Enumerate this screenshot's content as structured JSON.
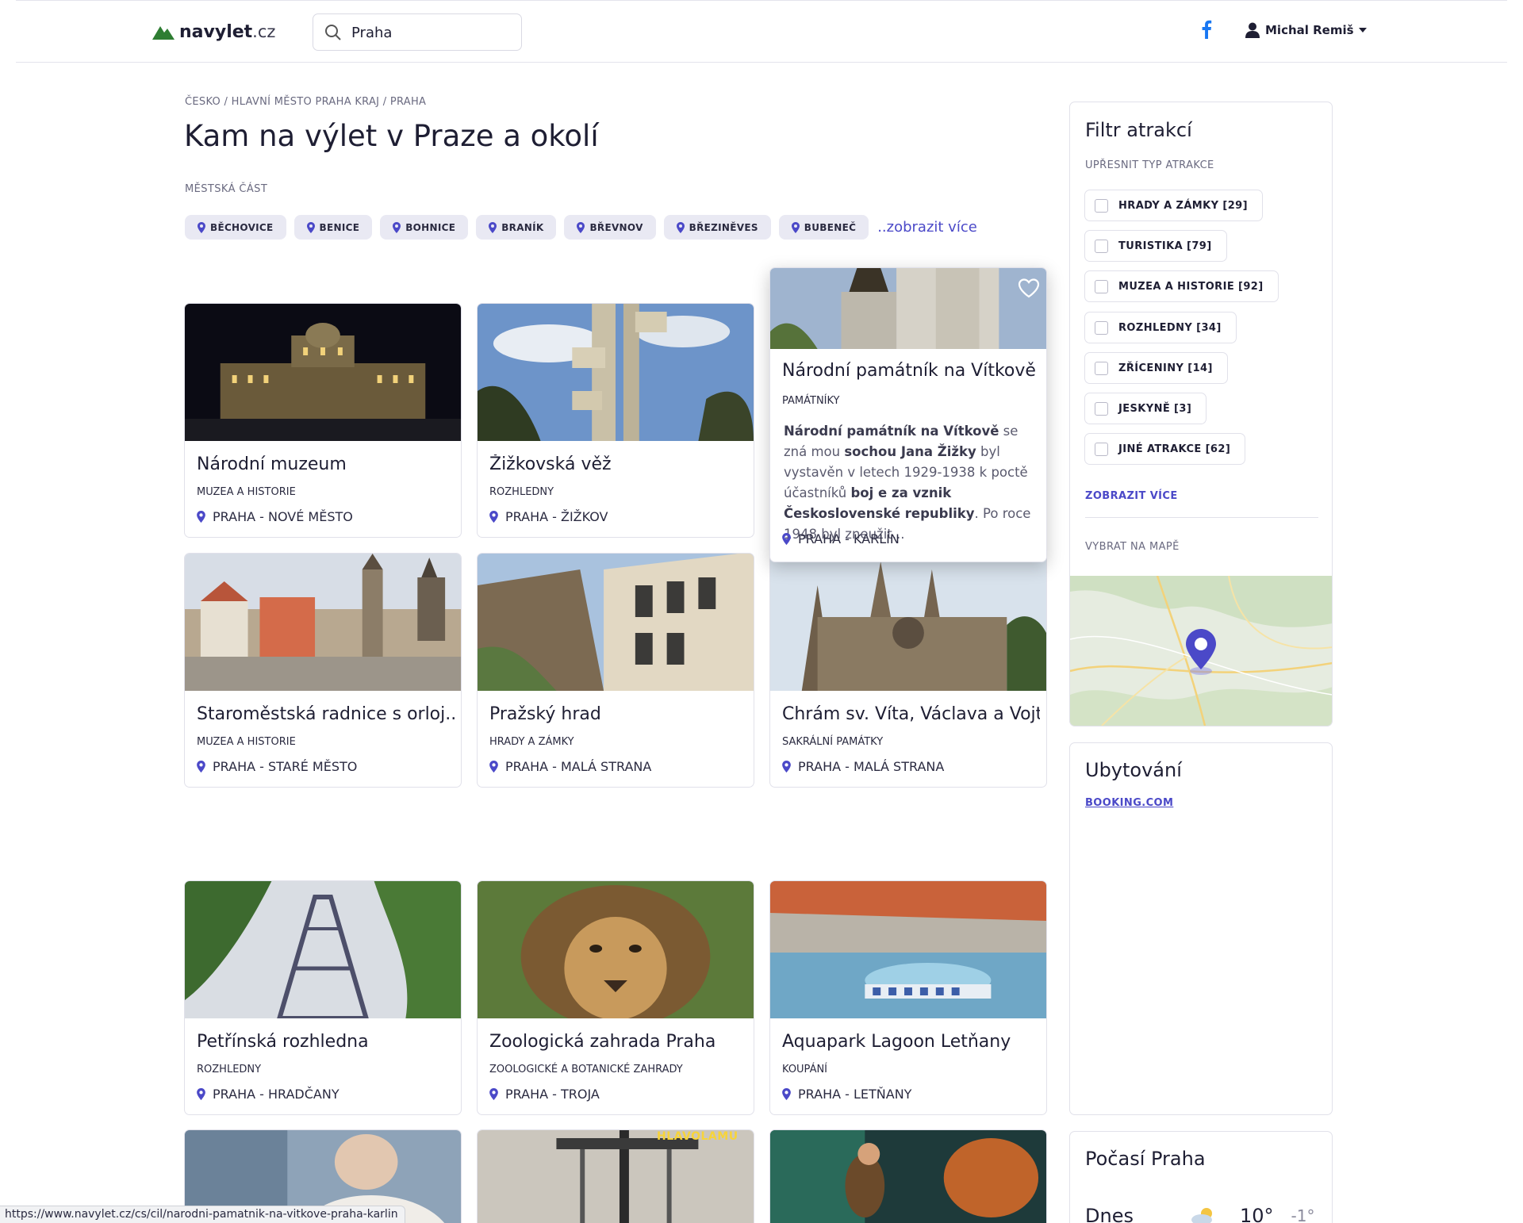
{
  "header": {
    "logo_bold": "navylet",
    "logo_tld": ".cz",
    "search_value": "Praha",
    "user_name": "Michal Remiš"
  },
  "breadcrumb": "ČESKO / HLAVNÍ MĚSTO PRAHA KRAJ / PRAHA",
  "page_title": "Kam na výlet v Praze a okolí",
  "districts": {
    "label": "MĚSTSKÁ ČÁST",
    "items": [
      "BĚCHOVICE",
      "BENICE",
      "BOHNICE",
      "BRANÍK",
      "BŘEVNOV",
      "BŘEZINĚVES",
      "BUBENEČ"
    ],
    "more": "..zobrazit více"
  },
  "cards": [
    {
      "title": "Národní muzeum",
      "category": "MUZEA A HISTORIE",
      "location": "PRAHA - NOVÉ MĚSTO"
    },
    {
      "title": "Žižkovská věž",
      "category": "ROZHLEDNY",
      "location": "PRAHA - ŽIŽKOV"
    },
    {
      "title": "Národní památník na Vítkově",
      "category": "PAMÁTNÍKY",
      "location": "PRAHA - KARLÍN",
      "desc_b1": "Národní památník na Vítkově",
      "desc_t1": " se zná mou ",
      "desc_b2": "sochou Jana Žižky",
      "desc_t2": " byl vystavěn v letech 1929-1938 k poctě účastníků ",
      "desc_b3": "boj e za vznik Československé republiky",
      "desc_t3": ". Po roce 1948 byl zneužit..."
    },
    {
      "title": "Staroměstská radnice s orloj...",
      "category": "MUZEA A HISTORIE",
      "location": "PRAHA - STARÉ MĚSTO"
    },
    {
      "title": "Pražský hrad",
      "category": "HRADY A ZÁMKY",
      "location": "PRAHA - MALÁ STRANA"
    },
    {
      "title": "Chrám sv. Víta, Václava a Vojt...",
      "category": "SAKRÁLNÍ PAMÁTKY",
      "location": "PRAHA - MALÁ STRANA"
    },
    {
      "title": "Petřínská rozhledna",
      "category": "ROZHLEDNY",
      "location": "PRAHA - HRADČANY"
    },
    {
      "title": "Zoologická zahrada Praha",
      "category": "ZOOLOGICKÉ A BOTANICKÉ ZAHRADY",
      "location": "PRAHA - TROJA"
    },
    {
      "title": "Aquapark Lagoon Letňany",
      "category": "KOUPÁNÍ",
      "location": "PRAHA - LETŇANY"
    }
  ],
  "partial_card_caption": "HLAVOLAMU",
  "filter": {
    "title": "Filtr atrakcí",
    "subtitle": "UPŘESNIT TYP ATRAKCE",
    "options": [
      "HRADY A ZÁMKY [29]",
      "TURISTIKA [79]",
      "MUZEA A HISTORIE [92]",
      "ROZHLEDNY [34]",
      "ZŘÍCENINY [14]",
      "JESKYNĚ [3]",
      "JINÉ ATRAKCE [62]"
    ],
    "more": "ZOBRAZIT VÍCE",
    "map_label": "VYBRAT NA MAPĚ"
  },
  "lodging": {
    "title": "Ubytování",
    "link": "BOOKING.COM"
  },
  "weather": {
    "title": "Počasí Praha",
    "day": "Dnes",
    "high": "10°",
    "low": "-1°"
  },
  "status_url": "https://www.navylet.cz/cs/cil/narodni-pamatnik-na-vitkove-praha-karlin",
  "colors": {
    "accent": "#4b49c8",
    "logo_green": "#2e7d32",
    "facebook": "#1877f2"
  }
}
